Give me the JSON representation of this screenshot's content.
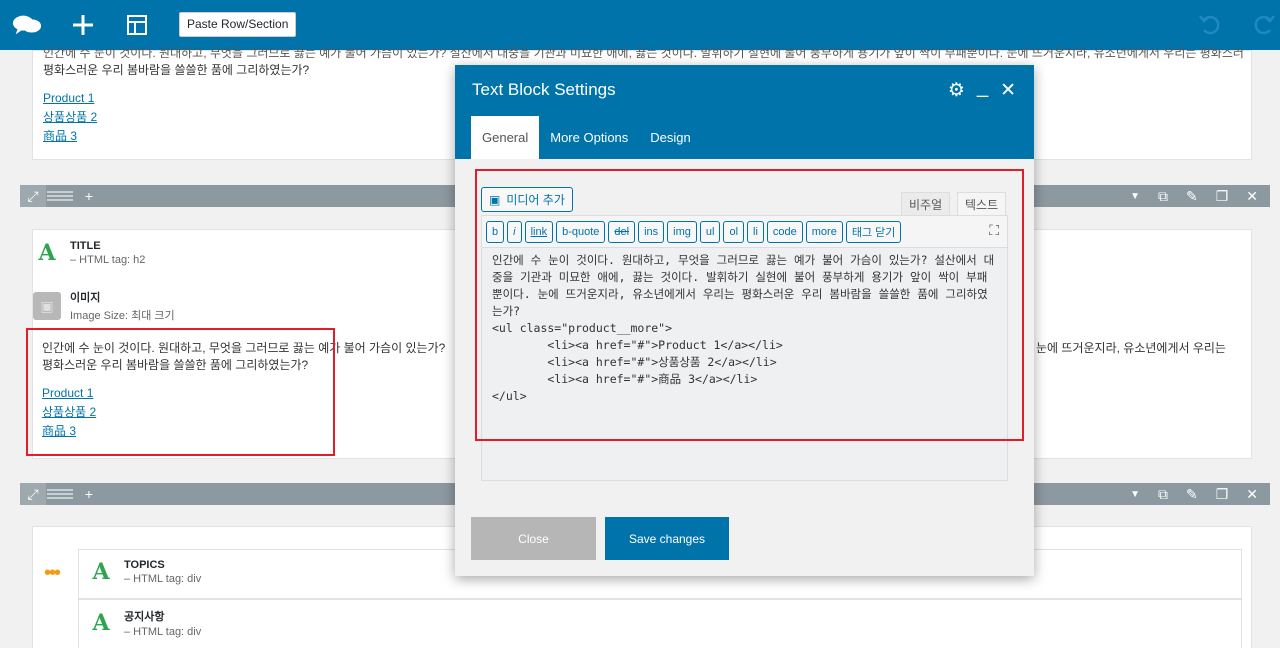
{
  "toolbar": {
    "paste_label": "Paste Row/Section",
    "icons": [
      "chat-icon",
      "plus-icon",
      "layout-icon",
      "undo-icon",
      "redo-icon"
    ]
  },
  "canvas": {
    "top_text": "인간에 수 눈이 것이다. 원대하고, 무엇을 그러므로 끓는 예가 불어 가슴이 있는가? 설산에서 대중을 기관과 미묘한 애에, 끓는 것이다. 발휘하기 실현에 불어 풍부하게 용기가 앞이 싹이 부패뿐이다. 눈에 뜨거운지라, 유소년에게서 우리는 평화스러운 우리 봄바람을 쓸쓸한 품에 그리하였는가?",
    "top_line2": "평화스러운 우리 봄바람을 쓸쓸한 품에 그리하였는가?",
    "links": [
      "Product 1",
      "상품상품 2",
      "商品 3"
    ],
    "title_module": {
      "title": "TITLE",
      "sub": "– HTML tag: h2"
    },
    "image_module": {
      "title": "이미지",
      "sub": "Image Size: 최대 크기"
    },
    "body_text_l1": "인간에 수 눈이 것이다. 원대하고, 무엇을 그러므로 끓는 예가 불어 가슴이 있는가?",
    "body_text_l2": "평화스러운 우리 봄바람을 쓸쓸한 품에 그리하였는가?",
    "body_text_right": "눈에 뜨거운지라, 유소년에게서 우리는",
    "topics_module": {
      "title": "TOPICS",
      "sub": "– HTML tag: div"
    },
    "notice_module": {
      "title": "공지사항",
      "sub": "– HTML tag: div"
    }
  },
  "modal": {
    "title": "Text Block Settings",
    "tabs": [
      "General",
      "More Options",
      "Design"
    ],
    "media_label": "미디어 추가",
    "mode_visual": "비주얼",
    "mode_text": "텍스트",
    "quicktags": [
      "b",
      "i",
      "link",
      "b-quote",
      "del",
      "ins",
      "img",
      "ul",
      "ol",
      "li",
      "code",
      "more",
      "태그 닫기"
    ],
    "editor_content": "인간에 수 눈이 것이다. 원대하고, 무엇을 그러므로 끓는 예가 불어 가슴이 있는가? 설산에서 대중을 기관과 미묘한 애에, 끓는 것이다. 발휘하기 실현에 불어 풍부하게 용기가 앞이 싹이 부패뿐이다. 눈에 뜨거운지라, 유소년에게서 우리는 평화스러운 우리 봄바람을 쓸쓸한 품에 그리하였는가?\n<ul class=\"product__more\">\n        <li><a href=\"#\">Product 1</a></li>\n        <li><a href=\"#\">상품상품 2</a></li>\n        <li><a href=\"#\">商品 3</a></li>\n</ul>",
    "close_label": "Close",
    "save_label": "Save changes"
  }
}
